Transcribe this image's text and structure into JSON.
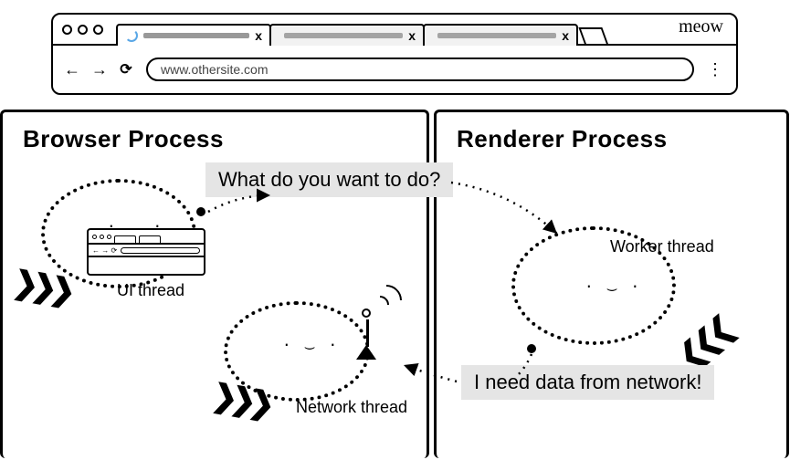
{
  "browser_window": {
    "meow": "meow",
    "nav": {
      "back": "←",
      "forward": "→",
      "reload": "⟳"
    },
    "url": "www.othersite.com",
    "menu": "⋮",
    "tabs": [
      {
        "loading": true,
        "close": "x"
      },
      {
        "loading": false,
        "close": "x"
      },
      {
        "loading": false,
        "close": "x"
      }
    ]
  },
  "processes": {
    "browser": {
      "title": "Browser Process"
    },
    "renderer": {
      "title": "Renderer Process"
    }
  },
  "threads": {
    "ui": "UI thread",
    "network": "Network thread",
    "worker": "Worker thread"
  },
  "speech": {
    "q": "What do you want to do?",
    "a": "I need data from network!"
  },
  "glyphs": {
    "face": ". ‿ .",
    "chevrons": "❯❯❯"
  }
}
